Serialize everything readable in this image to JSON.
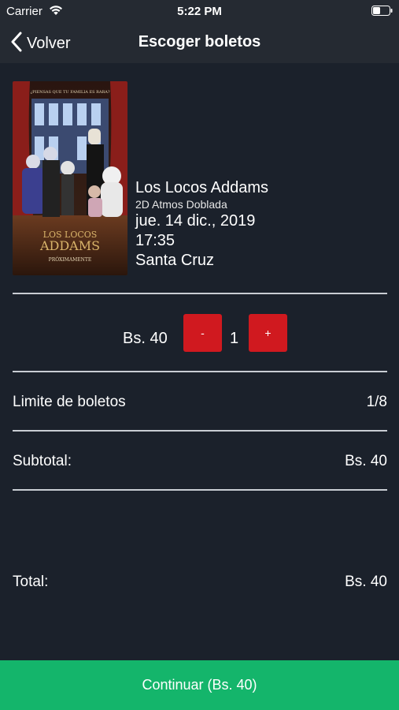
{
  "status_bar": {
    "carrier": "Carrier",
    "time": "5:22 PM"
  },
  "nav": {
    "back_label": "Volver",
    "title": "Escoger boletos"
  },
  "movie": {
    "poster_tagline": "¿PIENSAS QUE TU FAMILIA ES RARA?",
    "poster_title_line1": "LOS LOCOS",
    "poster_title_line2": "ADDAMS",
    "poster_footer": "PRÓXIMAMENTE",
    "title": "Los Locos Addams",
    "format": "2D Atmos Doblada",
    "date": "jue. 14 dic., 2019",
    "time": "17:35",
    "city": "Santa Cruz"
  },
  "ticket": {
    "price": "Bs. 40",
    "minus_label": "-",
    "plus_label": "+",
    "quantity": "1"
  },
  "summary": {
    "limit_label": "Limite de boletos",
    "limit_value": "1/8",
    "subtotal_label": "Subtotal:",
    "subtotal_value": "Bs. 40",
    "total_label": "Total:",
    "total_value": "Bs. 40"
  },
  "continue_label": "Continuar (Bs. 40)",
  "colors": {
    "background": "#1b212b",
    "bar": "#252a32",
    "stepper_button": "#d0191f",
    "continue_button": "#14b56b"
  }
}
